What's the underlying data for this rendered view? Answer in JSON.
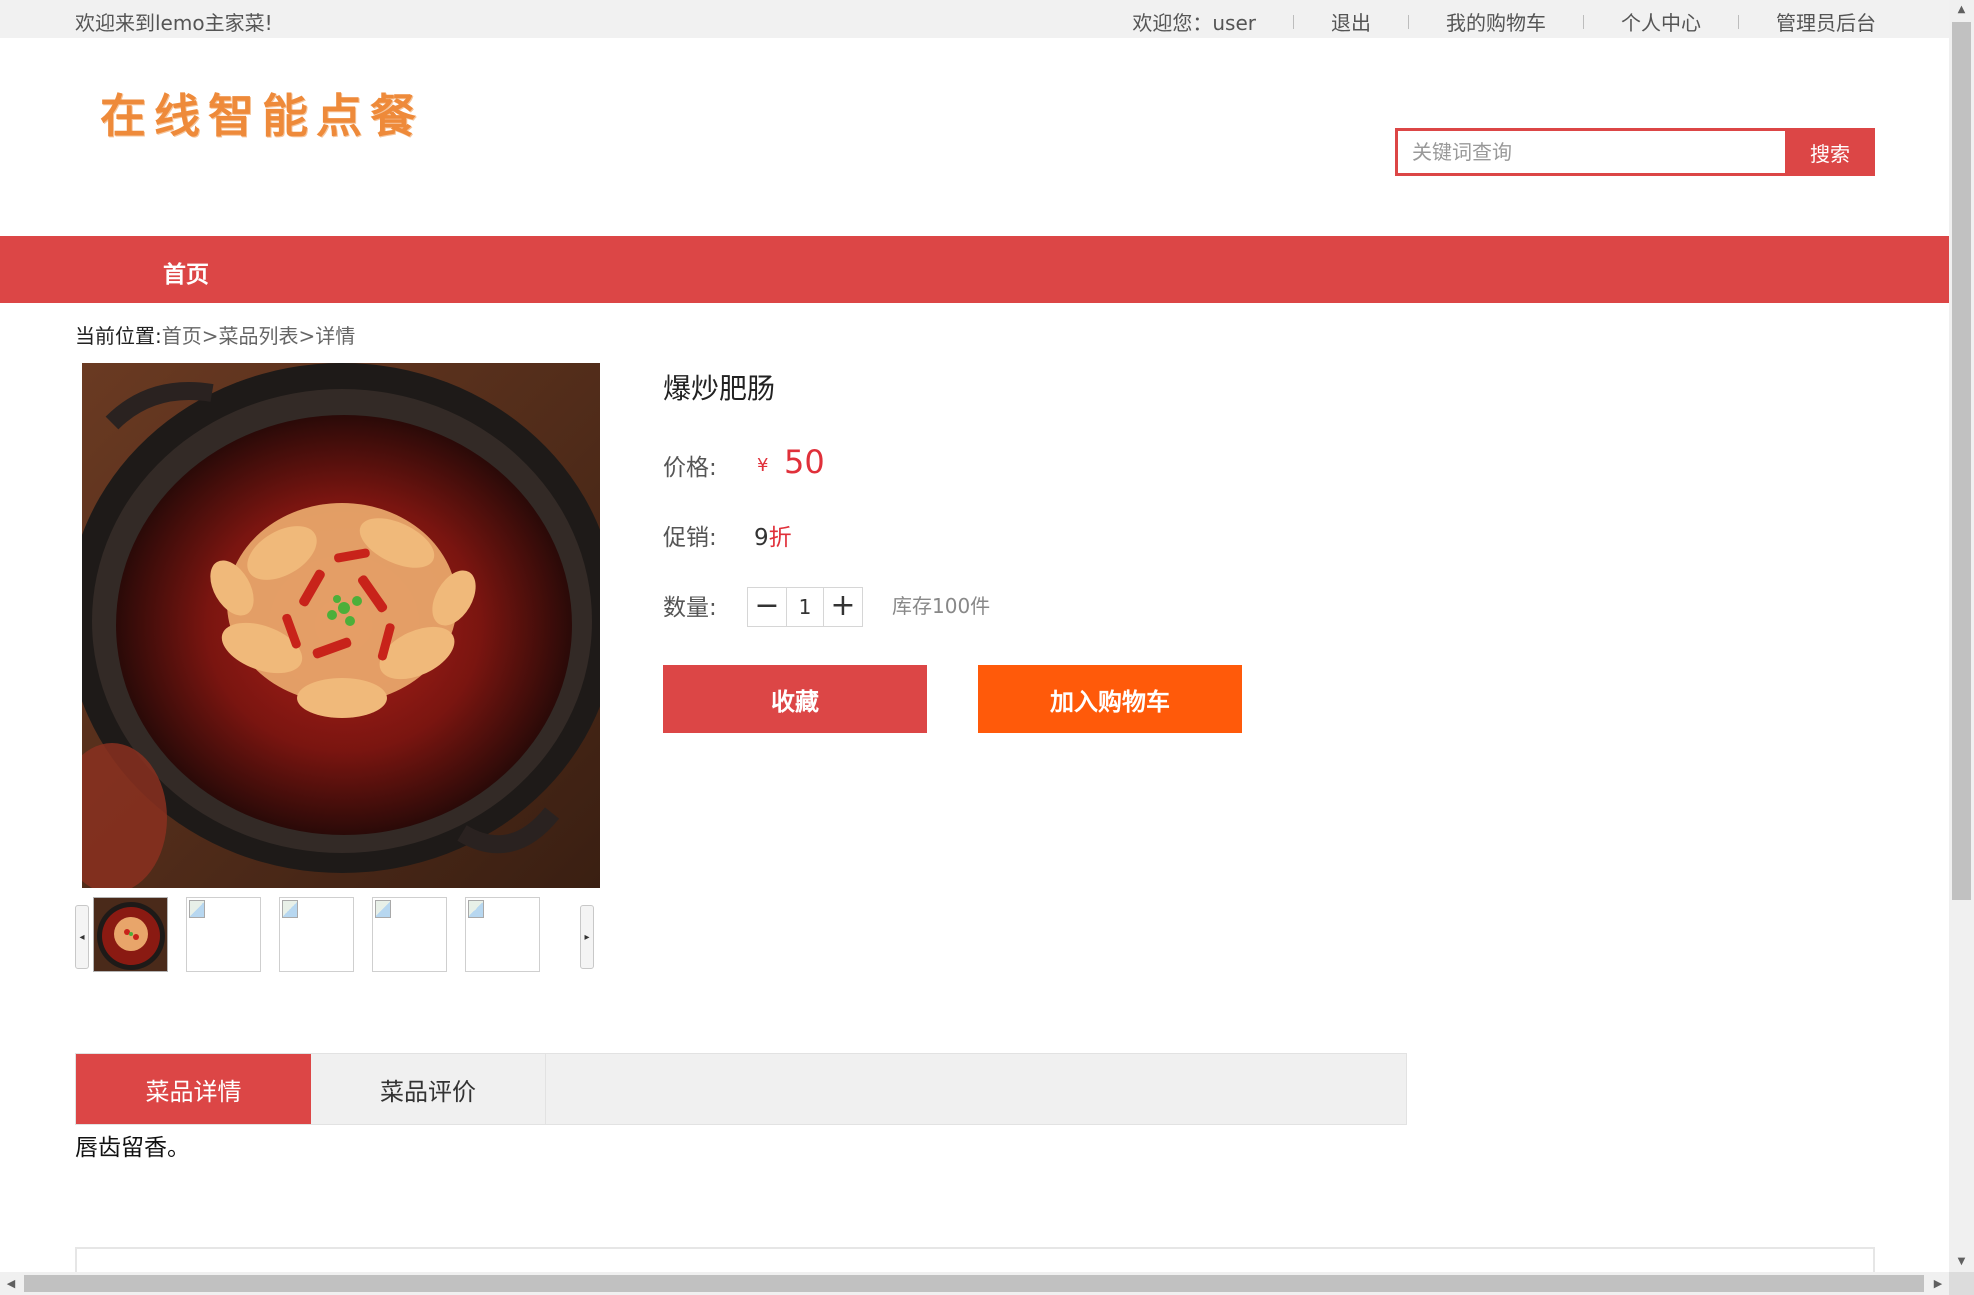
{
  "topbar": {
    "welcome": "欢迎来到lemo主家菜!",
    "greeting": "欢迎您：user",
    "logout": "退出",
    "cart": "我的购物车",
    "profile": "个人中心",
    "admin": "管理员后台"
  },
  "header": {
    "logo": "在线智能点餐",
    "search_placeholder": "关键词查询",
    "search_button": "搜索"
  },
  "nav": {
    "home": "首页"
  },
  "breadcrumb": {
    "prefix": "当前位置:",
    "home": "首页",
    "sep1": ">",
    "list": "菜品列表",
    "sep2": ">",
    "current": "详情"
  },
  "product": {
    "name": "爆炒肥肠",
    "price_label": "价格:",
    "currency": "¥",
    "price": "50",
    "promo_label": "促销:",
    "promo_value": "9",
    "promo_unit": "折",
    "qty_label": "数量:",
    "qty_minus": "−",
    "qty_value": "1",
    "qty_plus": "+",
    "stock": "库存100件",
    "favorite_button": "收藏",
    "cart_button": "加入购物车"
  },
  "gallery": {
    "thumb_count": 5,
    "selected_index": 0,
    "prev_arrow": "◂",
    "next_arrow": "▸"
  },
  "tabs": {
    "detail": "菜品详情",
    "reviews": "菜品评价",
    "active": "菜品详情"
  },
  "description": "唇齿留香。",
  "colors": {
    "accent": "#dc4646",
    "cart_orange": "#ff5a0a",
    "price_red": "#e0303a",
    "logo_orange": "#ee8a3a"
  }
}
